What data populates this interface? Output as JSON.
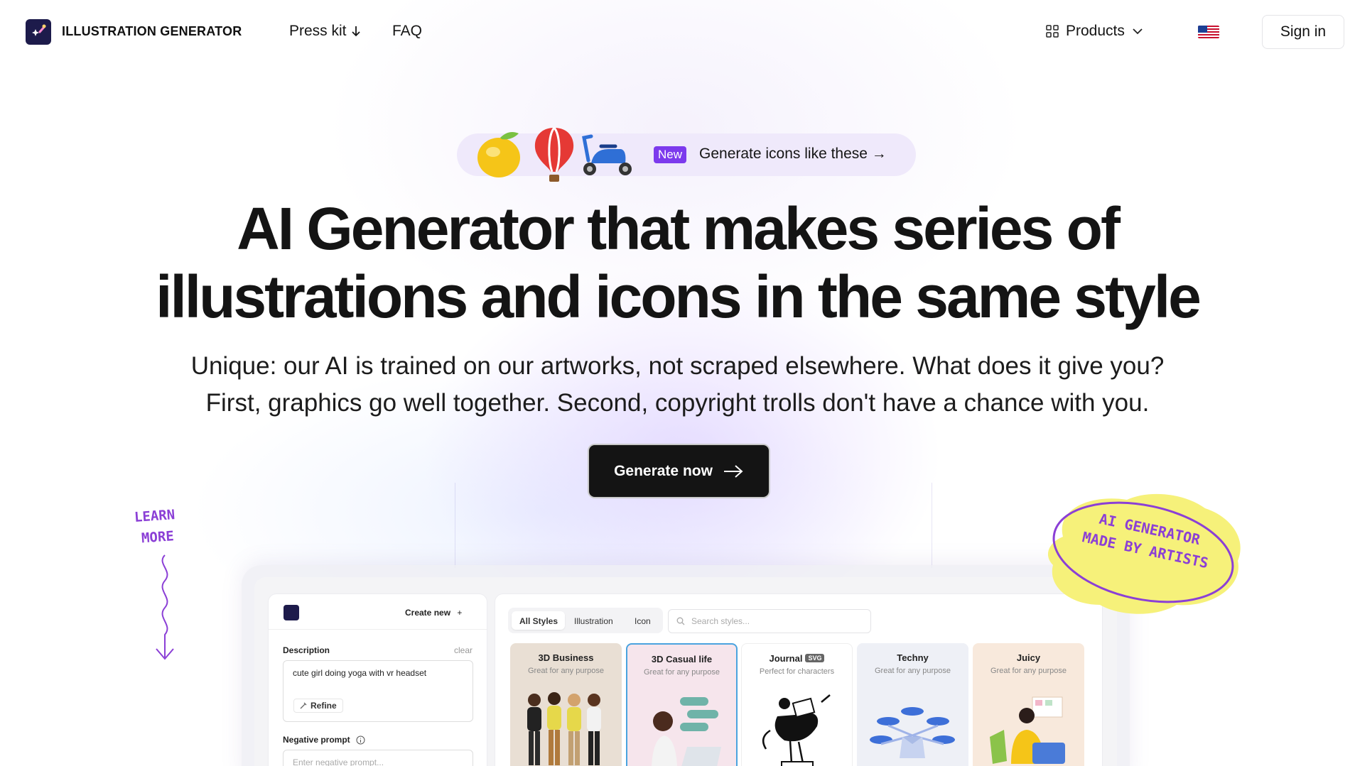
{
  "header": {
    "brand": "ILLUSTRATION GENERATOR",
    "nav": [
      {
        "label": "Press kit",
        "icon": "arrow-down-icon"
      },
      {
        "label": "FAQ"
      }
    ],
    "products_label": "Products",
    "language_flag": "us-flag-icon",
    "signin_label": "Sign in"
  },
  "promo": {
    "emojis": [
      "lemon",
      "hot-air-balloon",
      "scooter"
    ],
    "badge": "New",
    "cta": "Generate icons like these →"
  },
  "hero": {
    "title_line1": "AI Generator that makes series of",
    "title_line2": "illustrations and icons in the same style",
    "subtitle_line1": "Unique: our AI is trained on our artworks, not scraped elsewhere. What does it give you?",
    "subtitle_line2": "First, graphics go well together. Second, copyright trolls don't have a chance with you.",
    "cta": "Generate now"
  },
  "learn_more": {
    "line1": "LEARN",
    "line2": "MORE"
  },
  "sticker": {
    "line1": "AI GENERATOR",
    "line2": "MADE BY ARTISTS"
  },
  "app_preview": {
    "create_new": "Create new",
    "description_label": "Description",
    "clear_label": "clear",
    "description_value": "cute girl doing yoga with vr headset",
    "refine_label": "Refine",
    "negative_label": "Negative prompt",
    "negative_placeholder": "Enter negative prompt...",
    "tabs": [
      "All Styles",
      "Illustration",
      "Icon"
    ],
    "search_placeholder": "Search styles...",
    "styles": [
      {
        "title": "3D Business",
        "subtitle": "Great for any purpose",
        "bg": "#e9dfd4"
      },
      {
        "title": "3D Casual life",
        "subtitle": "Great for any purpose",
        "bg": "#f6e5ec"
      },
      {
        "title": "Journal",
        "tag": "SVG",
        "subtitle": "Perfect for characters",
        "bg": "#ffffff"
      },
      {
        "title": "Techny",
        "subtitle": "Great for any purpose",
        "bg": "#eef0f6"
      },
      {
        "title": "Juicy",
        "subtitle": "Great for any purpose",
        "bg": "#f8e9dc"
      }
    ]
  },
  "colors": {
    "accent": "#7c3aed",
    "dark": "#141414",
    "sticker_fill": "#f6f17a",
    "handwriting": "#8b3fd6"
  }
}
